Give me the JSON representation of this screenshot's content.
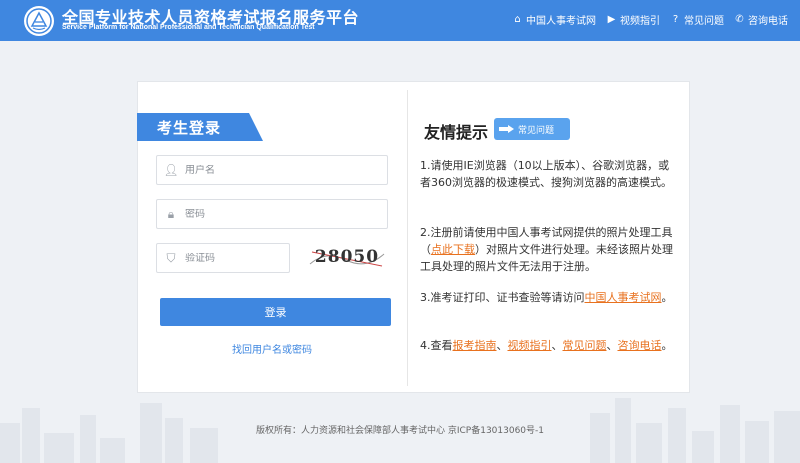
{
  "header": {
    "title": "全国专业技术人员资格考试报名服务平台",
    "subtitle": "Service Platform for National Professional and Technician Qualification Test",
    "nav": [
      {
        "label": "中国人事考试网",
        "icon": "home-icon"
      },
      {
        "label": "视频指引",
        "icon": "play-icon"
      },
      {
        "label": "常见问题",
        "icon": "question-icon"
      },
      {
        "label": "咨询电话",
        "icon": "phone-icon"
      }
    ]
  },
  "login": {
    "tab_label": "考生登录",
    "username_placeholder": "用户名",
    "password_placeholder": "密码",
    "captcha_placeholder": "验证码",
    "captcha_text": "28050",
    "login_button": "登录",
    "find_link": "找回用户名或密码"
  },
  "tips": {
    "title": "友情提示",
    "faq_badge": "常见问题",
    "tip1": "1.请使用IE浏览器（10以上版本）、谷歌浏览器，或者360浏览器的极速模式、搜狗浏览器的高速模式。",
    "tip2_a": "2.注册前请使用中国人事考试网提供的照片处理工具（",
    "tip2_link": "点此下载",
    "tip2_b": "）对照片文件进行处理。未经该照片处理工具处理的照片文件无法用于注册。",
    "tip3_a": "3.准考证打印、证书查验等请访问",
    "tip3_link": "中国人事考试网",
    "tip3_b": "。",
    "tip4_a": "4.查看",
    "tip4_link1": "报考指南",
    "tip4_sep1": "、",
    "tip4_link2": "视频指引",
    "tip4_sep2": "、",
    "tip4_link3": "常见问题",
    "tip4_sep3": "、",
    "tip4_link4": "咨询电话",
    "tip4_b": "。"
  },
  "footer": {
    "copyright": "版权所有：人力资源和社会保障部人事考试中心 京ICP备13013060号-1"
  },
  "colors": {
    "primary": "#3f87e0",
    "link_orange": "#e8711e",
    "background": "#eef1f5"
  }
}
